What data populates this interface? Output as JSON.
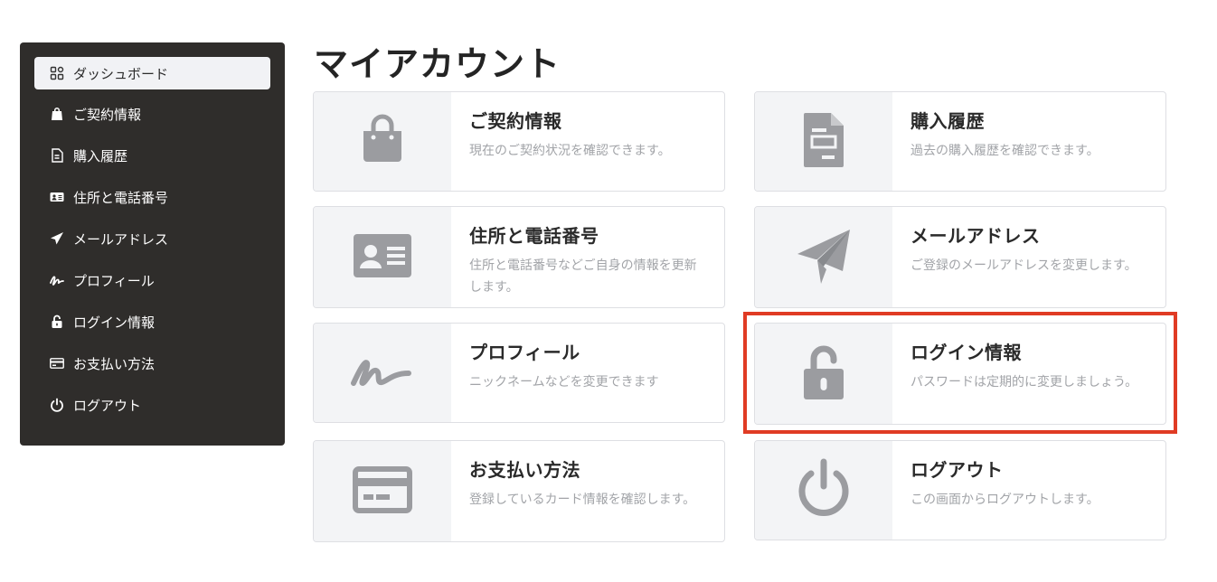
{
  "sidebar": {
    "items": [
      {
        "label": "ダッシュボード",
        "icon": "dashboard-icon",
        "active": true
      },
      {
        "label": "ご契約情報",
        "icon": "shopping-bag-icon"
      },
      {
        "label": "購入履歴",
        "icon": "document-icon"
      },
      {
        "label": "住所と電話番号",
        "icon": "id-card-icon"
      },
      {
        "label": "メールアドレス",
        "icon": "paper-plane-icon"
      },
      {
        "label": "プロフィール",
        "icon": "signature-icon"
      },
      {
        "label": "ログイン情報",
        "icon": "unlock-icon"
      },
      {
        "label": "お支払い方法",
        "icon": "credit-card-icon"
      },
      {
        "label": "ログアウト",
        "icon": "power-icon"
      }
    ]
  },
  "main": {
    "title": "マイアカウント",
    "cards": [
      {
        "title": "ご契約情報",
        "desc": "現在のご契約状況を確認できます。",
        "icon": "shopping-bag-icon"
      },
      {
        "title": "購入履歴",
        "desc": "過去の購入履歴を確認できます。",
        "icon": "document-icon"
      },
      {
        "title": "住所と電話番号",
        "desc": "住所と電話番号などご自身の情報を更新します。",
        "icon": "id-card-icon"
      },
      {
        "title": "メールアドレス",
        "desc": "ご登録のメールアドレスを変更します。",
        "icon": "paper-plane-icon"
      },
      {
        "title": "プロフィール",
        "desc": "ニックネームなどを変更できます",
        "icon": "signature-icon"
      },
      {
        "title": "ログイン情報",
        "desc": "パスワードは定期的に変更しましょう。",
        "icon": "unlock-icon",
        "highlighted": true
      },
      {
        "title": "お支払い方法",
        "desc": "登録しているカード情報を確認します。",
        "icon": "credit-card-icon"
      },
      {
        "title": "ログアウト",
        "desc": "この画面からログアウトします。",
        "icon": "power-icon"
      }
    ]
  },
  "colors": {
    "sidebar_bg": "#2f2d2b",
    "icon_gray": "#9b9ca0",
    "highlight": "#e03b24"
  }
}
